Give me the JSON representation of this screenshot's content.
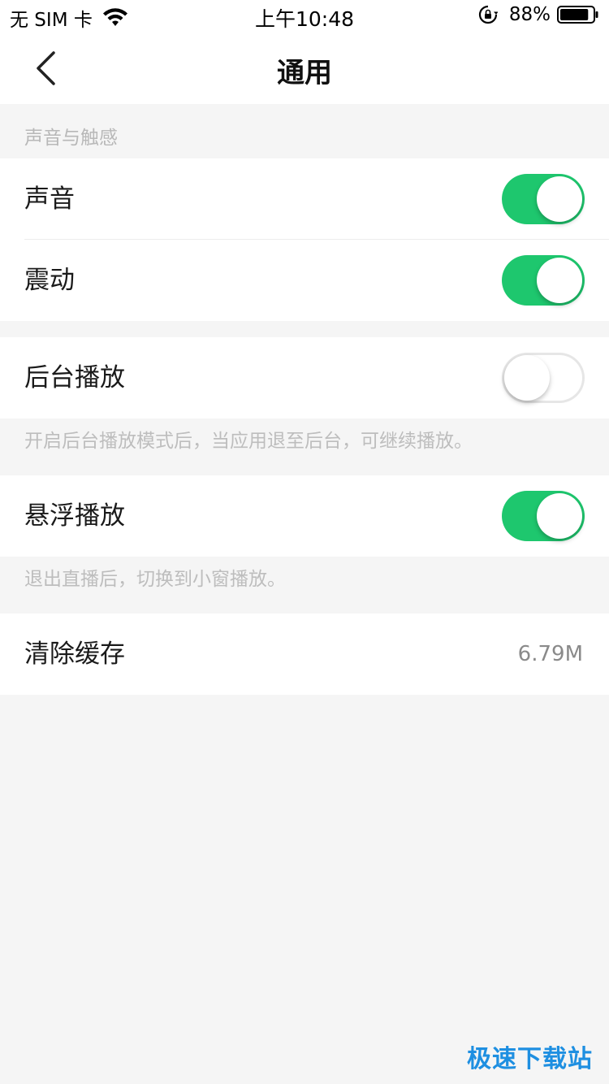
{
  "status_bar": {
    "carrier": "无 SIM 卡",
    "time": "上午10:48",
    "battery": "88%",
    "battery_level": 0.88
  },
  "nav": {
    "title": "通用"
  },
  "section_sound": {
    "header": "声音与触感",
    "sound": {
      "label": "声音",
      "on": true
    },
    "vibration": {
      "label": "震动",
      "on": true
    }
  },
  "background_play": {
    "label": "后台播放",
    "on": false,
    "hint": "开启后台播放模式后，当应用退至后台，可继续播放。"
  },
  "float_play": {
    "label": "悬浮播放",
    "on": true,
    "hint": "退出直播后，切换到小窗播放。"
  },
  "clear_cache": {
    "label": "清除缓存",
    "value": "6.79M"
  },
  "watermark": "极速下载站",
  "colors": {
    "switch_on": "#1ec76e",
    "background": "#f5f5f5"
  }
}
